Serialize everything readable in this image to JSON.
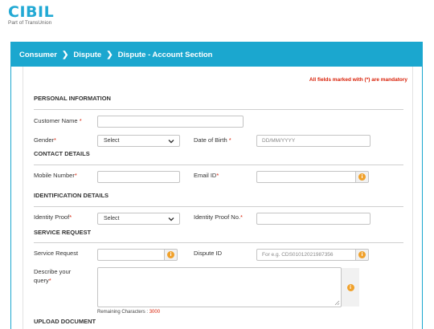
{
  "brand": {
    "name": "CIBIL",
    "tagline": "Part of TransUnion"
  },
  "breadcrumb": {
    "items": [
      "Consumer",
      "Dispute",
      "Dispute - Account Section"
    ]
  },
  "form": {
    "mandatory_note": "All fields marked with (*) are mandatory",
    "sections": {
      "personal": "PERSONAL INFORMATION",
      "contact": "CONTACT DETAILS",
      "identification": "IDENTIFICATION DETAILS",
      "service": "SERVICE REQUEST",
      "upload": "UPLOAD DOCUMENT"
    },
    "fields": {
      "customer_name": {
        "label": "Customer Name",
        "required": "*",
        "value": ""
      },
      "gender": {
        "label": "Gender",
        "required": "*",
        "selected": "Select"
      },
      "dob": {
        "label": "Date of Birth",
        "required": "*",
        "placeholder": "DD/MM/YYYY"
      },
      "mobile": {
        "label": "Mobile Number",
        "required": "*",
        "value": ""
      },
      "email": {
        "label": "Email ID",
        "required": "*",
        "value": ""
      },
      "identity_proof": {
        "label": "Identity Proof",
        "required": "*",
        "selected": "Select"
      },
      "identity_proof_no": {
        "label": "Identity Proof No.",
        "required": "*",
        "value": ""
      },
      "service_request": {
        "label": "Service Request",
        "value": ""
      },
      "dispute_id": {
        "label": "Dispute ID",
        "placeholder": "For e.g. CDS01012021987356"
      },
      "query": {
        "label_line1": "Describe your",
        "label_line2": "query",
        "required": "*",
        "remaining_label": "Remaining Characters :",
        "remaining_count": "3000"
      }
    }
  },
  "icons": {
    "info": "info-icon",
    "chevron": "chevron-down-icon",
    "breadcrumb_sep": "chevron-right-icon"
  },
  "colors": {
    "brand": "#22a9d4",
    "header": "#1ba7cf",
    "required": "#d81e05",
    "info": "#f0a12b"
  }
}
